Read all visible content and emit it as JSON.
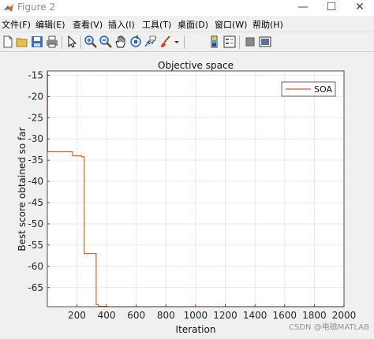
{
  "window": {
    "title": "Figure 2"
  },
  "menu": [
    "文件(F)",
    "编辑(E)",
    "查看(V)",
    "插入(I)",
    "工具(T)",
    "桌面(D)",
    "窗口(W)",
    "帮助(H)"
  ],
  "toolbar": {
    "icons": [
      "new-figure-icon",
      "open-file-icon",
      "save-icon",
      "print-icon",
      "pointer-icon",
      "zoom-in-icon",
      "zoom-out-icon",
      "pan-icon",
      "rotate-3d-icon",
      "data-cursor-icon",
      "brush-icon",
      "dropdown-arrow-icon",
      "colorbar-icon",
      "legend-icon",
      "hide-plot-tools-icon",
      "show-plot-tools-icon"
    ]
  },
  "watermark": "CSDN @电磁MATLAB",
  "chart_data": {
    "type": "line",
    "title": "Objective space",
    "xlabel": "Iteration",
    "ylabel": "Best score obtained so far",
    "xlim": [
      1,
      2000
    ],
    "ylim": [
      -69.5,
      -14
    ],
    "xticks": [
      200,
      400,
      600,
      800,
      1000,
      1200,
      1400,
      1600,
      1800,
      2000
    ],
    "yticks": [
      -15,
      -20,
      -25,
      -30,
      -35,
      -40,
      -45,
      -50,
      -55,
      -60,
      -65
    ],
    "grid": true,
    "legend_position": "top-right",
    "series": [
      {
        "name": "SOA",
        "color": "#d95319",
        "x": [
          1,
          2,
          2,
          170,
          170,
          230,
          230,
          250,
          250,
          330,
          330,
          345,
          345,
          400,
          400,
          2000
        ],
        "y": [
          -14,
          -14,
          -33,
          -33,
          -34,
          -34,
          -34.2,
          -34.2,
          -57,
          -57,
          -69,
          -69,
          -69.4,
          -69.4,
          -69.5,
          -69.5
        ]
      }
    ]
  }
}
